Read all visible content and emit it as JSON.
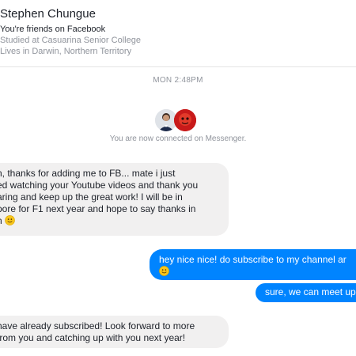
{
  "profile": {
    "name": "Stephen Chungue",
    "friend_status": "You're friends on Facebook",
    "studied": "Studied at Casuarina Senior College",
    "lives": "Lives in Darwin, Northern Territory"
  },
  "conversation": {
    "timestamp": "MON 2:48PM",
    "connected_text": "You are now connected on Messenger."
  },
  "messages": [
    {
      "direction": "incoming",
      "lines": [
        "n, thanks for adding me to FB... mate i just",
        "ed watching your Youtube videos and thank you",
        "aring and keep up the great work! I will be in",
        "pore for F1 next year and hope to say thanks in",
        "n"
      ],
      "emoji": "smile-emoji"
    },
    {
      "direction": "outgoing",
      "lines": [
        "hey nice nice! do subscribe to my channel ar"
      ],
      "emoji": "smile-emoji"
    },
    {
      "direction": "outgoing",
      "lines": [
        "sure, we can meet up"
      ]
    },
    {
      "direction": "incoming",
      "lines": [
        "have already subscribed! Look forward to more",
        "from you and catching up with you next year!"
      ]
    }
  ],
  "colors": {
    "outgoing_bubble": "#0084ff",
    "incoming_bubble": "#f1f0f0",
    "muted_text": "#90949c"
  }
}
